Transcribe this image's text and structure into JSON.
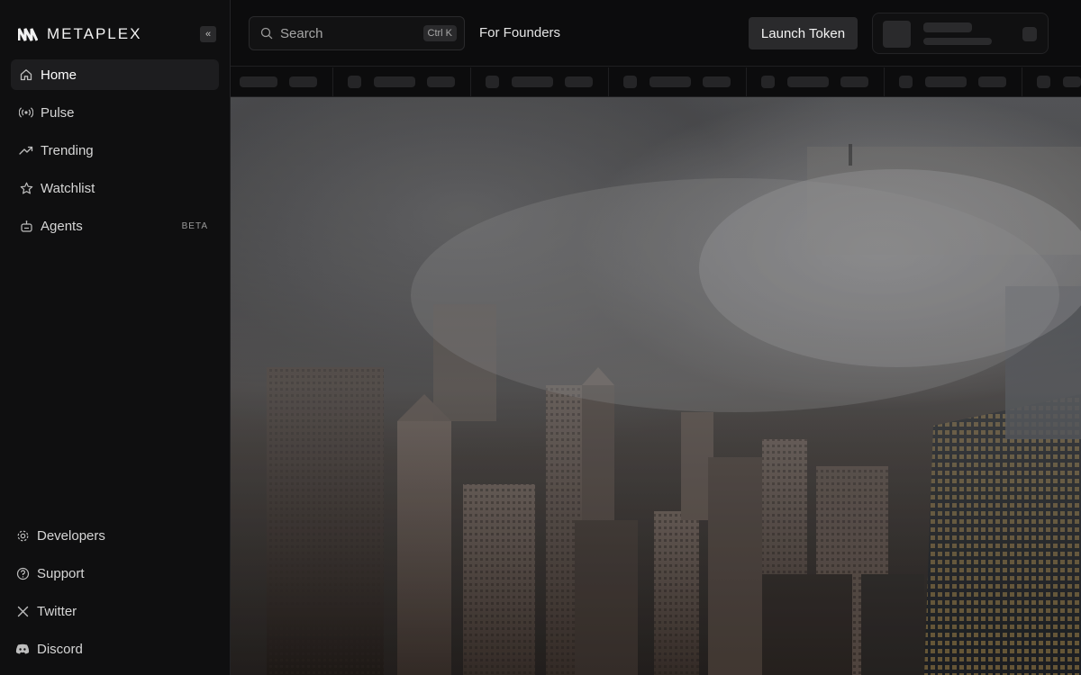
{
  "brand": {
    "name": "METAPLEX",
    "collapse_label": "«"
  },
  "sidebar": {
    "items": [
      {
        "label": "Home",
        "icon": "home-icon",
        "active": true
      },
      {
        "label": "Pulse",
        "icon": "broadcast-icon"
      },
      {
        "label": "Trending",
        "icon": "trending-icon"
      },
      {
        "label": "Watchlist",
        "icon": "star-icon"
      },
      {
        "label": "Agents",
        "icon": "robot-icon",
        "badge": "BETA"
      }
    ],
    "bottom_items": [
      {
        "label": "Developers",
        "icon": "gear-icon"
      },
      {
        "label": "Support",
        "icon": "help-icon"
      },
      {
        "label": "Twitter",
        "icon": "x-icon"
      },
      {
        "label": "Discord",
        "icon": "discord-icon"
      }
    ]
  },
  "header": {
    "search_placeholder": "Search",
    "search_shortcut": "Ctrl K",
    "founders_link": "For Founders",
    "launch_button": "Launch Token"
  },
  "hero": {
    "scene": "foggy-city-skyline-image"
  },
  "colors": {
    "background": "#0c0c0d",
    "sidebar": "#0f0f10",
    "skeleton": "#2a2a2c",
    "window_light": "#e8b85a"
  }
}
